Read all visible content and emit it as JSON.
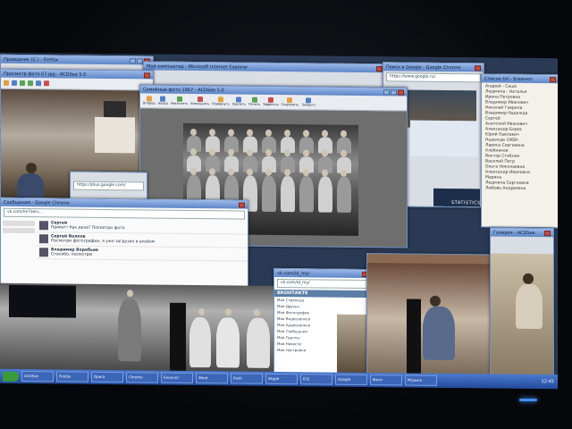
{
  "windows": {
    "back_left_title": "Проводник (C:) - Firefox",
    "viewer_left_title": "Просмотр фото 07.jpg - ACDSee 5.0",
    "viewer_main_title": "Семейные фото 1967 - ACDSee 5.0",
    "browser_top_title": "Мой компьютер - Microsoft Internet Explorer",
    "browser_right_title": "Поиск в Google - Google Chrome",
    "notepad_title": "Список.txt - Блокнот",
    "toolbar_labels": [
      "Вперед",
      "Назад",
      "Увеличить",
      "Уменьшить",
      "Повернуть",
      "Удалить",
      "Печать",
      "Эффекты",
      "Сохранить",
      "Закрыть"
    ],
    "chat_title": "Сообщения - Google Chrome",
    "chat_url": "vk.com/im?sel=...",
    "vk_url": "vk.com/id_my/",
    "vk_logo": "ВКОНТАКТЕ",
    "small_url": "https://plus.google.com/",
    "right_url": "https://www.google.ru/",
    "bottom_right_title": "Галерея - ACDSee"
  },
  "chat": {
    "rows": [
      {
        "name": "Сергей",
        "text": "Привет! Как дела? Посмотри фото"
      },
      {
        "name": "Сергей Волков",
        "text": "Посмотри фотографии, я уже загрузил в альбом"
      },
      {
        "name": "Владимир Воробьев",
        "text": "Спасибо, посмотрю"
      }
    ]
  },
  "vk_menu": [
    "Моя Страница",
    "Мои Друзья",
    "Мои Фотографии",
    "Мои Видеозаписи",
    "Мои Аудиозаписи",
    "Мои Сообщения",
    "Мои Группы",
    "Мои Новости",
    "Мои Настройки"
  ],
  "notepad_lines": [
    "Андрей - Саша",
    "Людмила - Наталья",
    "Ирина Петровна",
    "Владимир Иванович",
    "Николай Гаврила",
    "Владимир Надежда",
    "Сергей",
    "Анатолий Иванович",
    "Александр Борис",
    "Юрий Павлович",
    "Надежда 1968г.",
    "Лариса Сергеевна",
    "Хлебников",
    "Виктор Стеблин",
    "Василий Петр",
    "Ольга Николаевна",
    "Александр Ивановна",
    "Марина",
    "Людмила Сергеевна",
    "Любовь Андреевна"
  ],
  "statistics_label": "STATISTICS",
  "taskbar": {
    "tasks": [
      "ACDSee",
      "Firefox",
      "Opera",
      "Chrome",
      "Блокнот",
      "Word",
      "Paint",
      "Skype",
      "ICQ",
      "Google",
      "Фото",
      "Музыка"
    ],
    "clock": "12:45"
  },
  "colors": {
    "accent": "#5d86c8",
    "taskbar": "#234a9a",
    "led": "#3e8bff"
  }
}
